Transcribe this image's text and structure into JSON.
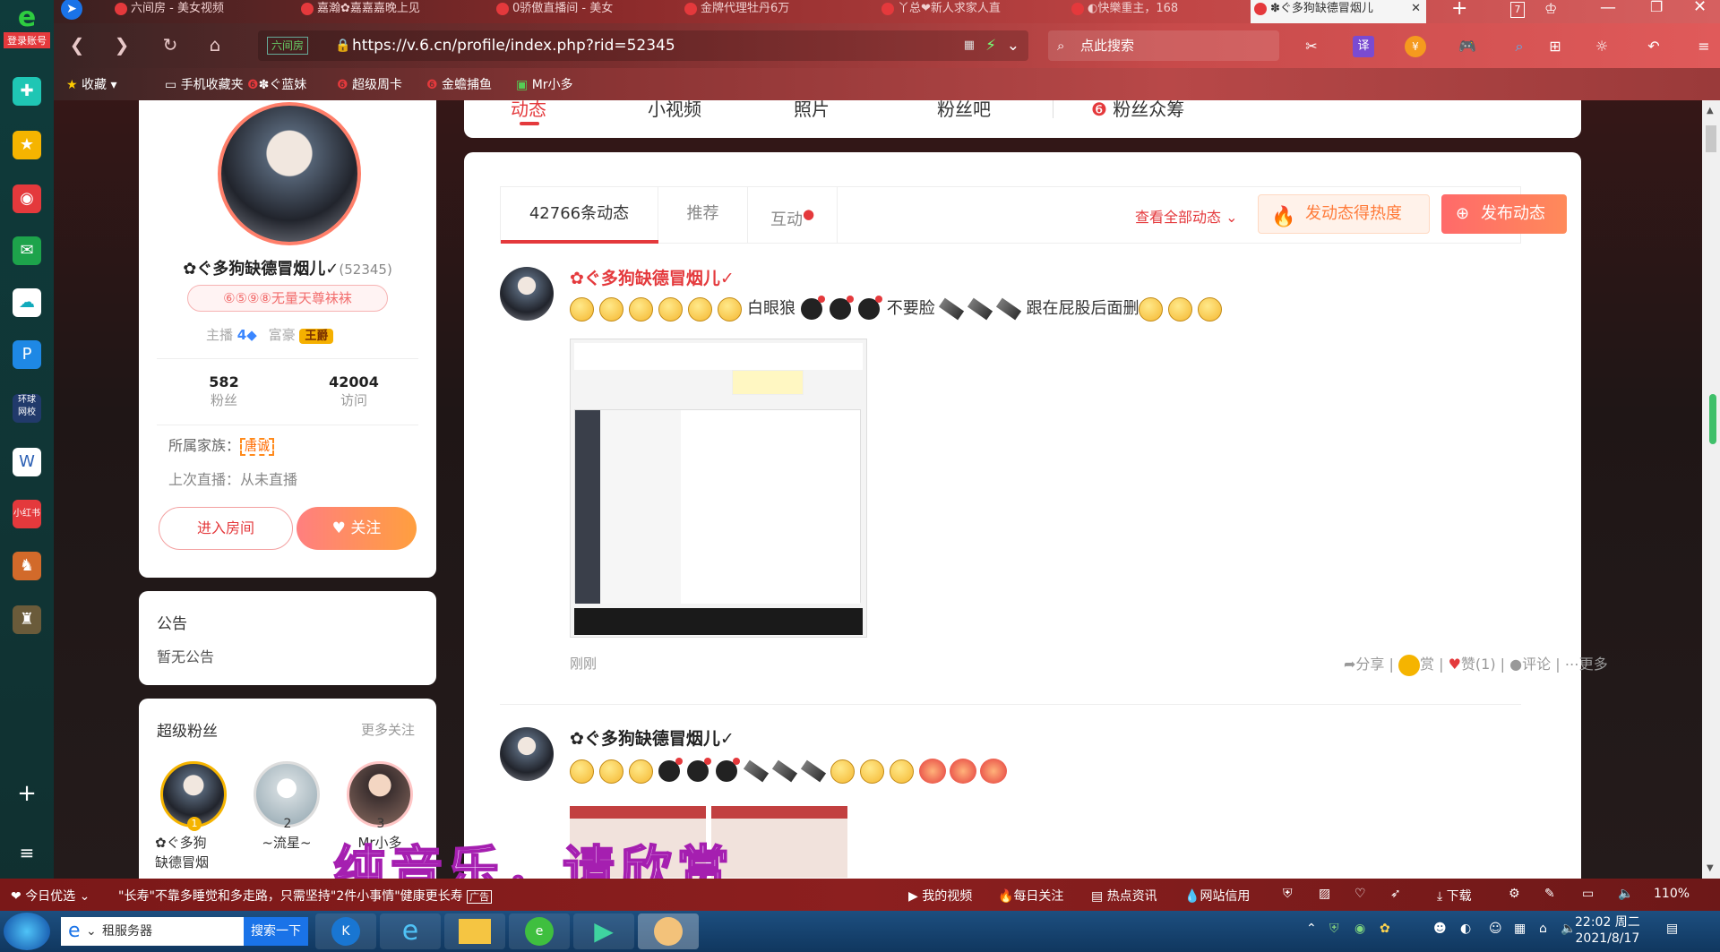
{
  "sidebar": {
    "logo_label": "登录账号",
    "apps": [
      "green-plus-icon",
      "star-icon",
      "weibo-icon",
      "mail-icon",
      "cloud-icon",
      "p-icon",
      "globe-news-icon",
      "word-doc-icon",
      "xiaohongshu-icon",
      "game-icon",
      "castle-game-icon"
    ],
    "add_label": "+",
    "menu_label": "≡"
  },
  "tabs": [
    {
      "label": "六间房 - 美女视频"
    },
    {
      "label": "嘉瀚✿嘉嘉嘉晚上见"
    },
    {
      "label": "0骄傲直播间 - 美女"
    },
    {
      "label": "金牌代理牡丹6万"
    },
    {
      "label": "丫总❤新人求家人直"
    },
    {
      "label": "◐快樂重主，168"
    },
    {
      "label": "✽ぐ多狗缺德冒烟儿"
    }
  ],
  "tab_actions": {
    "new_tab": "+",
    "count": "7"
  },
  "address": {
    "site_badge": "六间房",
    "url": "https://v.6.cn/profile/index.php?rid=52345",
    "search_placeholder": "点此搜索"
  },
  "bookmarks": [
    "收藏",
    "手机收藏夹",
    "✽ぐ蓝妹",
    "超级周卡",
    "金蟾捕鱼",
    "Mr小多"
  ],
  "profile": {
    "name": "✿ぐ多狗缺德冒烟儿✓",
    "rid": "(52345)",
    "title_badge": "⑥⑤⑨⑧无量天尊袜袜",
    "anchor_label": "主播",
    "anchor_level": "4",
    "rich_label": "富豪",
    "rich_badge": "王爵",
    "fans_count": "582",
    "fans_label": "粉丝",
    "visits_count": "42004",
    "visits_label": "访问",
    "family_label": "所属家族：",
    "family_badge": "唐诚",
    "last_live": "上次直播：从未直播",
    "enter_room": "进入房间",
    "follow": "关注"
  },
  "notice": {
    "title": "公告",
    "body": "暂无公告"
  },
  "superfans": {
    "title": "超级粉丝",
    "more": "更多关注",
    "fans": [
      {
        "rank": "1",
        "name": "✿ぐ多狗\n缺德冒烟"
      },
      {
        "rank": "2",
        "name": "~流星~"
      },
      {
        "rank": "3",
        "name": "Mr小多"
      }
    ]
  },
  "top_tabs": [
    "动态",
    "小视频",
    "照片",
    "粉丝吧",
    "粉丝众筹"
  ],
  "feed_tabs": {
    "count_tab": "42766条动态",
    "recommend": "推荐",
    "interact": "互动",
    "view_all": "查看全部动态",
    "hot_btn": "发动态得热度",
    "post_btn": "发布动态"
  },
  "posts": [
    {
      "author": "✿ぐ多狗缺德冒烟儿✓",
      "text_a": "白眼狼",
      "text_b": "不要脸",
      "text_c": "跟在屁股后面删",
      "time": "刚刚",
      "share": "分享",
      "reward": "赏",
      "like": "赞(1)",
      "comment": "评论",
      "more": "更多"
    },
    {
      "author": "✿ぐ多狗缺德冒烟儿✓"
    }
  ],
  "overlay_subtitle": "纯音乐，请欣赏",
  "statusbar": {
    "today": "今日优选",
    "ticker": "\"长寿\"不靠多睡觉和多走路，只需坚持\"2件小事情\"健康更长寿",
    "ad": "广告",
    "my_video": "我的视频",
    "daily": "每日关注",
    "hot_news": "热点资讯",
    "credit": "网站信用",
    "download": "下载",
    "zoom": "110%"
  },
  "taskbar": {
    "search_text": "租服务器",
    "search_btn": "搜索一下",
    "time": "22:02 周二",
    "date": "2021/8/17"
  },
  "colors": {
    "accent": "#e4393c",
    "orange": "#ff7b3a"
  }
}
